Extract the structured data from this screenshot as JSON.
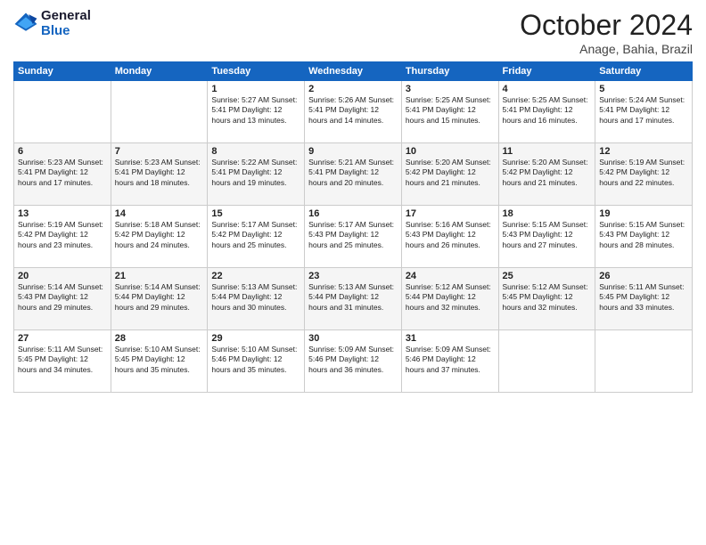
{
  "header": {
    "logo_line1": "General",
    "logo_line2": "Blue",
    "month_title": "October 2024",
    "location": "Anage, Bahia, Brazil"
  },
  "days_of_week": [
    "Sunday",
    "Monday",
    "Tuesday",
    "Wednesday",
    "Thursday",
    "Friday",
    "Saturday"
  ],
  "weeks": [
    [
      {
        "day": "",
        "content": ""
      },
      {
        "day": "",
        "content": ""
      },
      {
        "day": "1",
        "content": "Sunrise: 5:27 AM\nSunset: 5:41 PM\nDaylight: 12 hours and 13 minutes."
      },
      {
        "day": "2",
        "content": "Sunrise: 5:26 AM\nSunset: 5:41 PM\nDaylight: 12 hours and 14 minutes."
      },
      {
        "day": "3",
        "content": "Sunrise: 5:25 AM\nSunset: 5:41 PM\nDaylight: 12 hours and 15 minutes."
      },
      {
        "day": "4",
        "content": "Sunrise: 5:25 AM\nSunset: 5:41 PM\nDaylight: 12 hours and 16 minutes."
      },
      {
        "day": "5",
        "content": "Sunrise: 5:24 AM\nSunset: 5:41 PM\nDaylight: 12 hours and 17 minutes."
      }
    ],
    [
      {
        "day": "6",
        "content": "Sunrise: 5:23 AM\nSunset: 5:41 PM\nDaylight: 12 hours and 17 minutes."
      },
      {
        "day": "7",
        "content": "Sunrise: 5:23 AM\nSunset: 5:41 PM\nDaylight: 12 hours and 18 minutes."
      },
      {
        "day": "8",
        "content": "Sunrise: 5:22 AM\nSunset: 5:41 PM\nDaylight: 12 hours and 19 minutes."
      },
      {
        "day": "9",
        "content": "Sunrise: 5:21 AM\nSunset: 5:41 PM\nDaylight: 12 hours and 20 minutes."
      },
      {
        "day": "10",
        "content": "Sunrise: 5:20 AM\nSunset: 5:42 PM\nDaylight: 12 hours and 21 minutes."
      },
      {
        "day": "11",
        "content": "Sunrise: 5:20 AM\nSunset: 5:42 PM\nDaylight: 12 hours and 21 minutes."
      },
      {
        "day": "12",
        "content": "Sunrise: 5:19 AM\nSunset: 5:42 PM\nDaylight: 12 hours and 22 minutes."
      }
    ],
    [
      {
        "day": "13",
        "content": "Sunrise: 5:19 AM\nSunset: 5:42 PM\nDaylight: 12 hours and 23 minutes."
      },
      {
        "day": "14",
        "content": "Sunrise: 5:18 AM\nSunset: 5:42 PM\nDaylight: 12 hours and 24 minutes."
      },
      {
        "day": "15",
        "content": "Sunrise: 5:17 AM\nSunset: 5:42 PM\nDaylight: 12 hours and 25 minutes."
      },
      {
        "day": "16",
        "content": "Sunrise: 5:17 AM\nSunset: 5:43 PM\nDaylight: 12 hours and 25 minutes."
      },
      {
        "day": "17",
        "content": "Sunrise: 5:16 AM\nSunset: 5:43 PM\nDaylight: 12 hours and 26 minutes."
      },
      {
        "day": "18",
        "content": "Sunrise: 5:15 AM\nSunset: 5:43 PM\nDaylight: 12 hours and 27 minutes."
      },
      {
        "day": "19",
        "content": "Sunrise: 5:15 AM\nSunset: 5:43 PM\nDaylight: 12 hours and 28 minutes."
      }
    ],
    [
      {
        "day": "20",
        "content": "Sunrise: 5:14 AM\nSunset: 5:43 PM\nDaylight: 12 hours and 29 minutes."
      },
      {
        "day": "21",
        "content": "Sunrise: 5:14 AM\nSunset: 5:44 PM\nDaylight: 12 hours and 29 minutes."
      },
      {
        "day": "22",
        "content": "Sunrise: 5:13 AM\nSunset: 5:44 PM\nDaylight: 12 hours and 30 minutes."
      },
      {
        "day": "23",
        "content": "Sunrise: 5:13 AM\nSunset: 5:44 PM\nDaylight: 12 hours and 31 minutes."
      },
      {
        "day": "24",
        "content": "Sunrise: 5:12 AM\nSunset: 5:44 PM\nDaylight: 12 hours and 32 minutes."
      },
      {
        "day": "25",
        "content": "Sunrise: 5:12 AM\nSunset: 5:45 PM\nDaylight: 12 hours and 32 minutes."
      },
      {
        "day": "26",
        "content": "Sunrise: 5:11 AM\nSunset: 5:45 PM\nDaylight: 12 hours and 33 minutes."
      }
    ],
    [
      {
        "day": "27",
        "content": "Sunrise: 5:11 AM\nSunset: 5:45 PM\nDaylight: 12 hours and 34 minutes."
      },
      {
        "day": "28",
        "content": "Sunrise: 5:10 AM\nSunset: 5:45 PM\nDaylight: 12 hours and 35 minutes."
      },
      {
        "day": "29",
        "content": "Sunrise: 5:10 AM\nSunset: 5:46 PM\nDaylight: 12 hours and 35 minutes."
      },
      {
        "day": "30",
        "content": "Sunrise: 5:09 AM\nSunset: 5:46 PM\nDaylight: 12 hours and 36 minutes."
      },
      {
        "day": "31",
        "content": "Sunrise: 5:09 AM\nSunset: 5:46 PM\nDaylight: 12 hours and 37 minutes."
      },
      {
        "day": "",
        "content": ""
      },
      {
        "day": "",
        "content": ""
      }
    ]
  ]
}
